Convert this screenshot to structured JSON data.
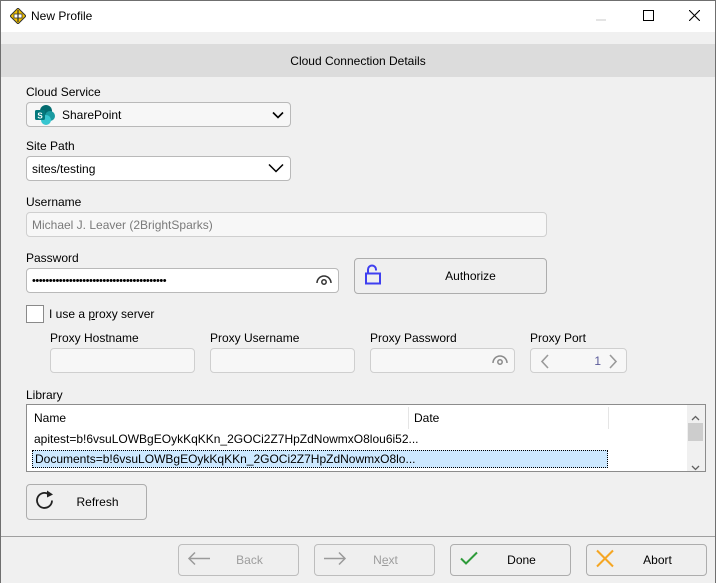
{
  "window": {
    "title": "New Profile",
    "app_icon": "app-logo-icon",
    "controls": [
      "minimize-icon",
      "maximize-icon",
      "close-icon"
    ]
  },
  "section_header": "Cloud Connection Details",
  "cloud_service": {
    "label": "Cloud Service",
    "value": "SharePoint",
    "icon": "sharepoint-icon",
    "colors": {
      "dark": "#036c70",
      "mid": "#1a9ba1",
      "light": "#37c6d0"
    }
  },
  "site_path": {
    "label": "Site Path",
    "value": "sites/testing"
  },
  "username": {
    "label": "Username",
    "value": "Michael J. Leaver (2BrightSparks)"
  },
  "password": {
    "label": "Password",
    "value": "••••••••••••••••••••••••••••••••••••••••",
    "reveal_icon": "eye-icon"
  },
  "authorize": {
    "label": "Authorize",
    "icon": "unlocked-padlock-icon",
    "icon_color": "#3f3ff0"
  },
  "proxy": {
    "checkbox_label_pre": "I use a ",
    "checkbox_label_accel": "p",
    "checkbox_label_post": "roxy server",
    "checked": false,
    "hostname_label": "Proxy Hostname",
    "hostname_value": "",
    "username_label": "Proxy Username",
    "username_value": "",
    "password_label": "Proxy Password",
    "password_value": "",
    "port_label": "Proxy Port",
    "port_value": "1"
  },
  "library": {
    "label": "Library",
    "columns": [
      "Name",
      "Date"
    ],
    "rows": [
      {
        "name": "apitest=b!6vsuLOWBgEOykKqKKn_2GOCi2Z7HpZdNowmxO8lou6i52...",
        "date": "",
        "selected": false
      },
      {
        "name": "Documents=b!6vsuLOWBgEOykKqKKn_2GOCi2Z7HpZdNowmxO8lo...",
        "date": "",
        "selected": true
      }
    ]
  },
  "refresh": {
    "label": "Refresh",
    "icon": "refresh-icon"
  },
  "footer": {
    "back": {
      "label": "Back",
      "enabled": false,
      "icon": "arrow-left-icon"
    },
    "next": {
      "label_pre": "N",
      "label_accel": "e",
      "label_post": "xt",
      "enabled": false,
      "icon": "arrow-right-icon"
    },
    "done": {
      "label": "Done",
      "icon": "checkmark-icon",
      "icon_color": "#2e9b3a"
    },
    "abort": {
      "label": "Abort",
      "icon": "x-icon",
      "icon_color": "#f5a623"
    }
  }
}
